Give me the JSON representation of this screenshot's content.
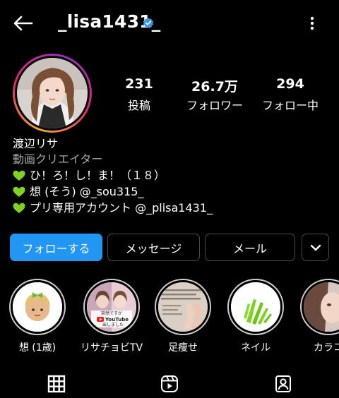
{
  "header": {
    "username": "_lisa1431_",
    "icons": {
      "back": "arrow-left-icon",
      "verified": "verified-badge-icon",
      "more": "more-vertical-icon"
    }
  },
  "colors": {
    "background": "#000000",
    "accent": "#2196f3",
    "verified": "#3897f0",
    "heart": "#7ed321",
    "muted": "#a8a8a8"
  },
  "stats": [
    {
      "value": "231",
      "label": "投稿"
    },
    {
      "value": "26.7万",
      "label": "フォロワー"
    },
    {
      "value": "294",
      "label": "フォロー中"
    }
  ],
  "bio": {
    "name": "渡辺リサ",
    "category": "動画クリエイター",
    "lines": [
      "ひ！ろ！し！ま！（１８）",
      "想 (そう) @_sou315_",
      "プリ専用アカウント @_plisa1431_"
    ],
    "line_icon": "green-heart-icon"
  },
  "actions": {
    "follow": "フォローする",
    "message": "メッセージ",
    "mail": "メール",
    "more_icon": "chevron-down-icon"
  },
  "highlights": [
    {
      "label": "想 (1歳)"
    },
    {
      "label": "リサチョビTV",
      "overlay_lines": [
        "突然ですが",
        "YouTube",
        "出しました"
      ]
    },
    {
      "label": "足痩せ"
    },
    {
      "label": "ネイル"
    },
    {
      "label": "カラコ"
    }
  ],
  "tabs": [
    {
      "icon": "grid-icon"
    },
    {
      "icon": "reels-icon"
    },
    {
      "icon": "tagged-icon"
    }
  ]
}
